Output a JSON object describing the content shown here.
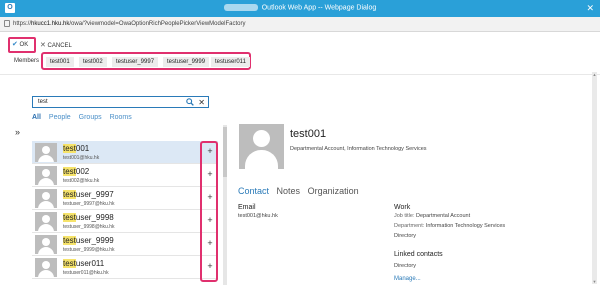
{
  "titlebar": {
    "title": "Outlook Web App -- Webpage Dialog",
    "close_glyph": "✕"
  },
  "urlbar": {
    "url_prefix": "https://",
    "url_host": "hkucc1.hku.hk",
    "url_path": "/owa/?viewmodel=OwaOptionRichPeoplePickerViewModelFactory"
  },
  "toolbar": {
    "ok_label": "OK",
    "cancel_label": "CANCEL"
  },
  "members": {
    "label": "Members",
    "chips": [
      "test001",
      "test002",
      "testuser_9997",
      "testuser_9999",
      "testuser011"
    ]
  },
  "search": {
    "value": "test",
    "clear_glyph": "✕"
  },
  "filters": {
    "items": [
      "All",
      "People",
      "Groups",
      "Rooms"
    ],
    "selected": "All"
  },
  "list": {
    "items": [
      {
        "name_hl": "test",
        "name_rest": "001",
        "email_hl": "test",
        "email_rest": "001@hku.hk",
        "selected": true
      },
      {
        "name_hl": "test",
        "name_rest": "002",
        "email_hl": "test",
        "email_rest": "002@hku.hk",
        "selected": false
      },
      {
        "name_hl": "test",
        "name_rest": "user_9997",
        "email_hl": "test",
        "email_rest": "user_9997@hku.hk",
        "selected": false
      },
      {
        "name_hl": "test",
        "name_rest": "user_9998",
        "email_hl": "test",
        "email_rest": "user_9998@hku.hk",
        "selected": false
      },
      {
        "name_hl": "test",
        "name_rest": "user_9999",
        "email_hl": "test",
        "email_rest": "user_9999@hku.hk",
        "selected": false
      },
      {
        "name_hl": "test",
        "name_rest": "user011",
        "email_hl": "test",
        "email_rest": "user011@hku.hk",
        "selected": false
      }
    ],
    "add_glyph": "+"
  },
  "detail": {
    "name": "test001",
    "subtitle": "Departmental Account, Information Technology Services",
    "tabs": [
      "Contact",
      "Notes",
      "Organization"
    ],
    "active_tab": "Contact",
    "email_heading": "Email",
    "email_value": "test001@hku.hk",
    "work_heading": "Work",
    "job_title_key": "Job title:",
    "job_title_value": "Departmental Account",
    "department_key": "Department:",
    "department_value": "Information Technology Services",
    "directory_line": "Directory",
    "linked_heading": "Linked contacts",
    "linked_value": "Directory",
    "manage_link": "Manage..."
  },
  "colors": {
    "accent": "#2a7ab8",
    "highlight_box": "#e0306e",
    "titlebar": "#2aa0d8",
    "search_highlight": "#f6e36a"
  }
}
